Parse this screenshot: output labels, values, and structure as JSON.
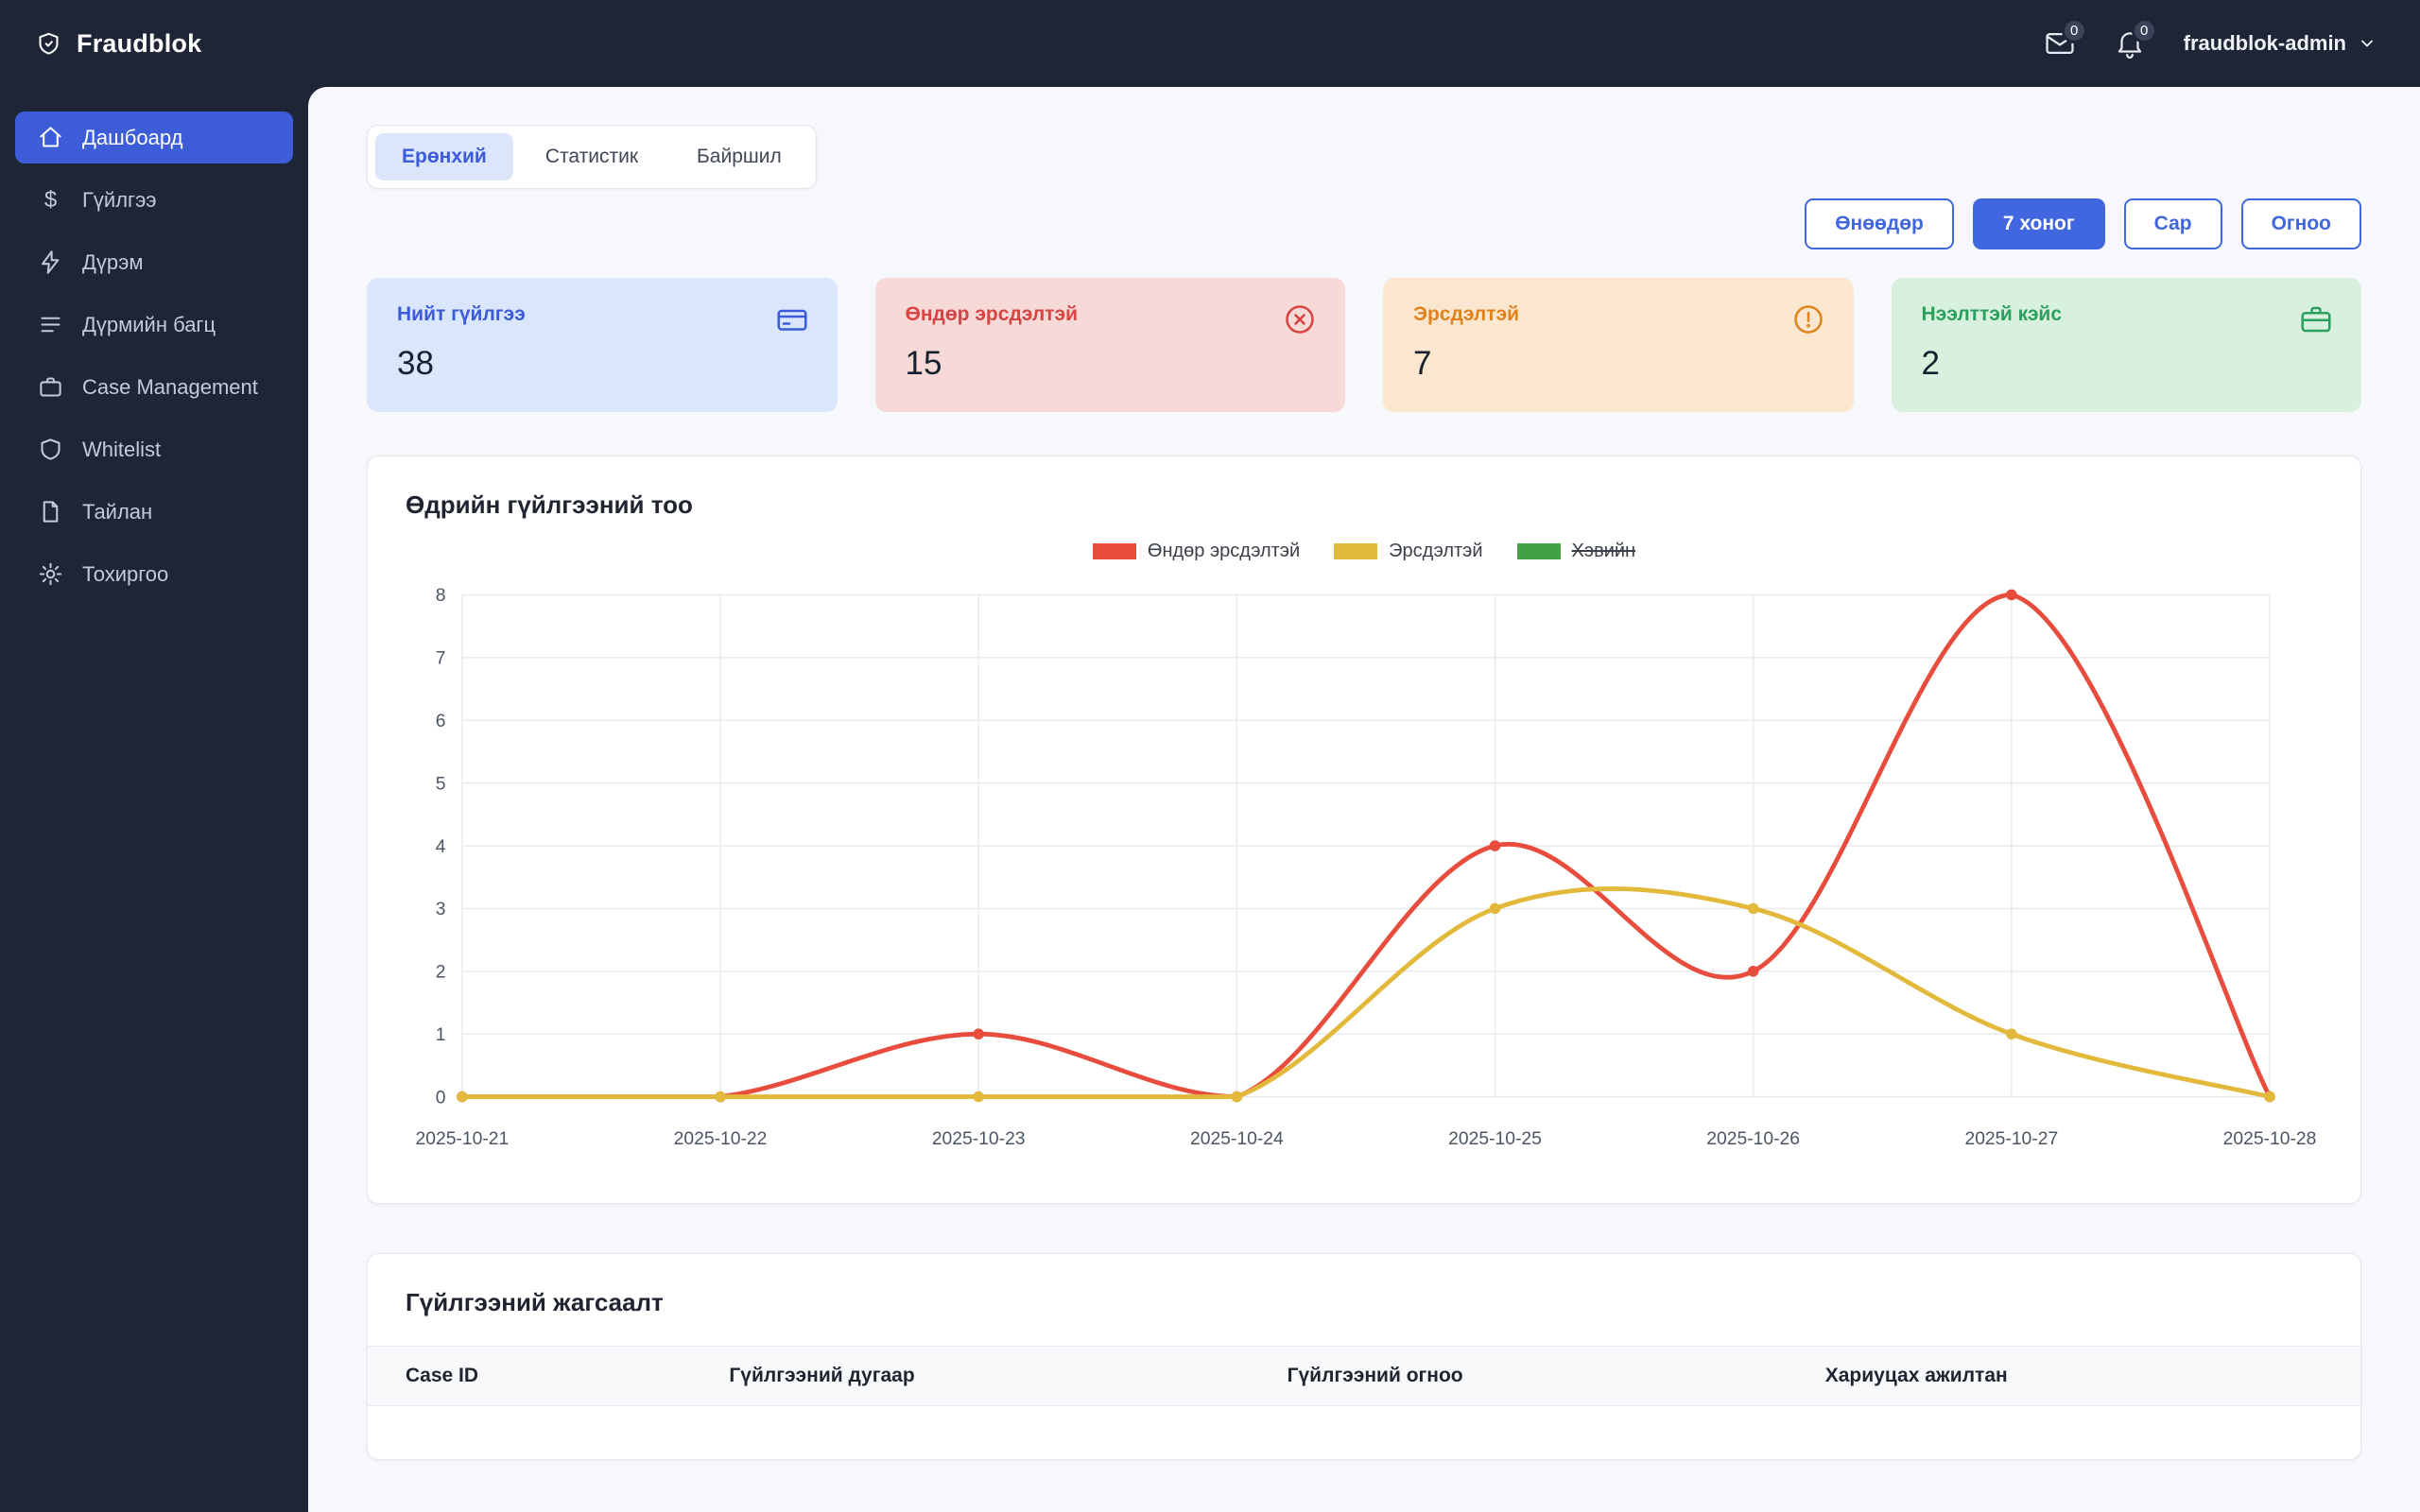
{
  "app": {
    "title": "Fraudblok"
  },
  "topbar": {
    "mail_badge": "0",
    "bell_badge": "0",
    "user": "fraudblok-admin"
  },
  "sidebar": {
    "items": [
      {
        "label": "Дашбоард",
        "icon": "home-icon",
        "active": true
      },
      {
        "label": "Гүйлгээ",
        "icon": "dollar-icon",
        "active": false
      },
      {
        "label": "Дүрэм",
        "icon": "bolt-icon",
        "active": false
      },
      {
        "label": "Дүрмийн багц",
        "icon": "list-icon",
        "active": false
      },
      {
        "label": "Case Management",
        "icon": "briefcase-icon",
        "active": false
      },
      {
        "label": "Whitelist",
        "icon": "shield-icon",
        "active": false
      },
      {
        "label": "Тайлан",
        "icon": "file-icon",
        "active": false
      },
      {
        "label": "Тохиргоо",
        "icon": "gear-icon",
        "active": false
      }
    ]
  },
  "tabs": [
    {
      "label": "Ерөнхий",
      "active": true
    },
    {
      "label": "Статистик",
      "active": false
    },
    {
      "label": "Байршил",
      "active": false
    }
  ],
  "filters": [
    {
      "label": "Өнөөдөр",
      "active": false
    },
    {
      "label": "7 хоног",
      "active": true
    },
    {
      "label": "Сар",
      "active": false
    },
    {
      "label": "Огноо",
      "active": false
    }
  ],
  "stats": [
    {
      "label": "Нийт гүйлгээ",
      "value": "38",
      "variant": "blue",
      "icon": "wallet-icon",
      "accent": "#3b5bdb"
    },
    {
      "label": "Өндөр эрсдэлтэй",
      "value": "15",
      "variant": "red",
      "icon": "x-circle-icon",
      "accent": "#d64541"
    },
    {
      "label": "Эрсдэлтэй",
      "value": "7",
      "variant": "orange",
      "icon": "alert-circle-icon",
      "accent": "#e0831d"
    },
    {
      "label": "Нээлттэй кэйс",
      "value": "2",
      "variant": "green",
      "icon": "briefcase-icon",
      "accent": "#2ba05e"
    }
  ],
  "chart_data": {
    "type": "line",
    "title": "Өдрийн гүйлгээний тоо",
    "categories": [
      "2025-10-21",
      "2025-10-22",
      "2025-10-23",
      "2025-10-24",
      "2025-10-25",
      "2025-10-26",
      "2025-10-27",
      "2025-10-28"
    ],
    "series": [
      {
        "name": "Өндөр эрсдэлтэй",
        "color": "#e74c3c",
        "values": [
          0,
          0,
          1,
          0,
          4,
          2,
          8,
          0
        ],
        "hidden": false
      },
      {
        "name": "Эрсдэлтэй",
        "color": "#e2b93b",
        "values": [
          0,
          0,
          0,
          0,
          3,
          3,
          1,
          0
        ],
        "hidden": false
      },
      {
        "name": "Хэвийн",
        "color": "#43a047",
        "values": [],
        "hidden": true
      }
    ],
    "ylim": [
      0,
      8
    ],
    "yticks": [
      0,
      1,
      2,
      3,
      4,
      5,
      6,
      7,
      8
    ],
    "grid": true,
    "legend_position": "top"
  },
  "table": {
    "title": "Гүйлгээний жагсаалт",
    "columns": [
      "Case ID",
      "Гүйлгээний дугаар",
      "Гүйлгээний огноо",
      "Хариуцах ажилтан"
    ],
    "rows": []
  }
}
